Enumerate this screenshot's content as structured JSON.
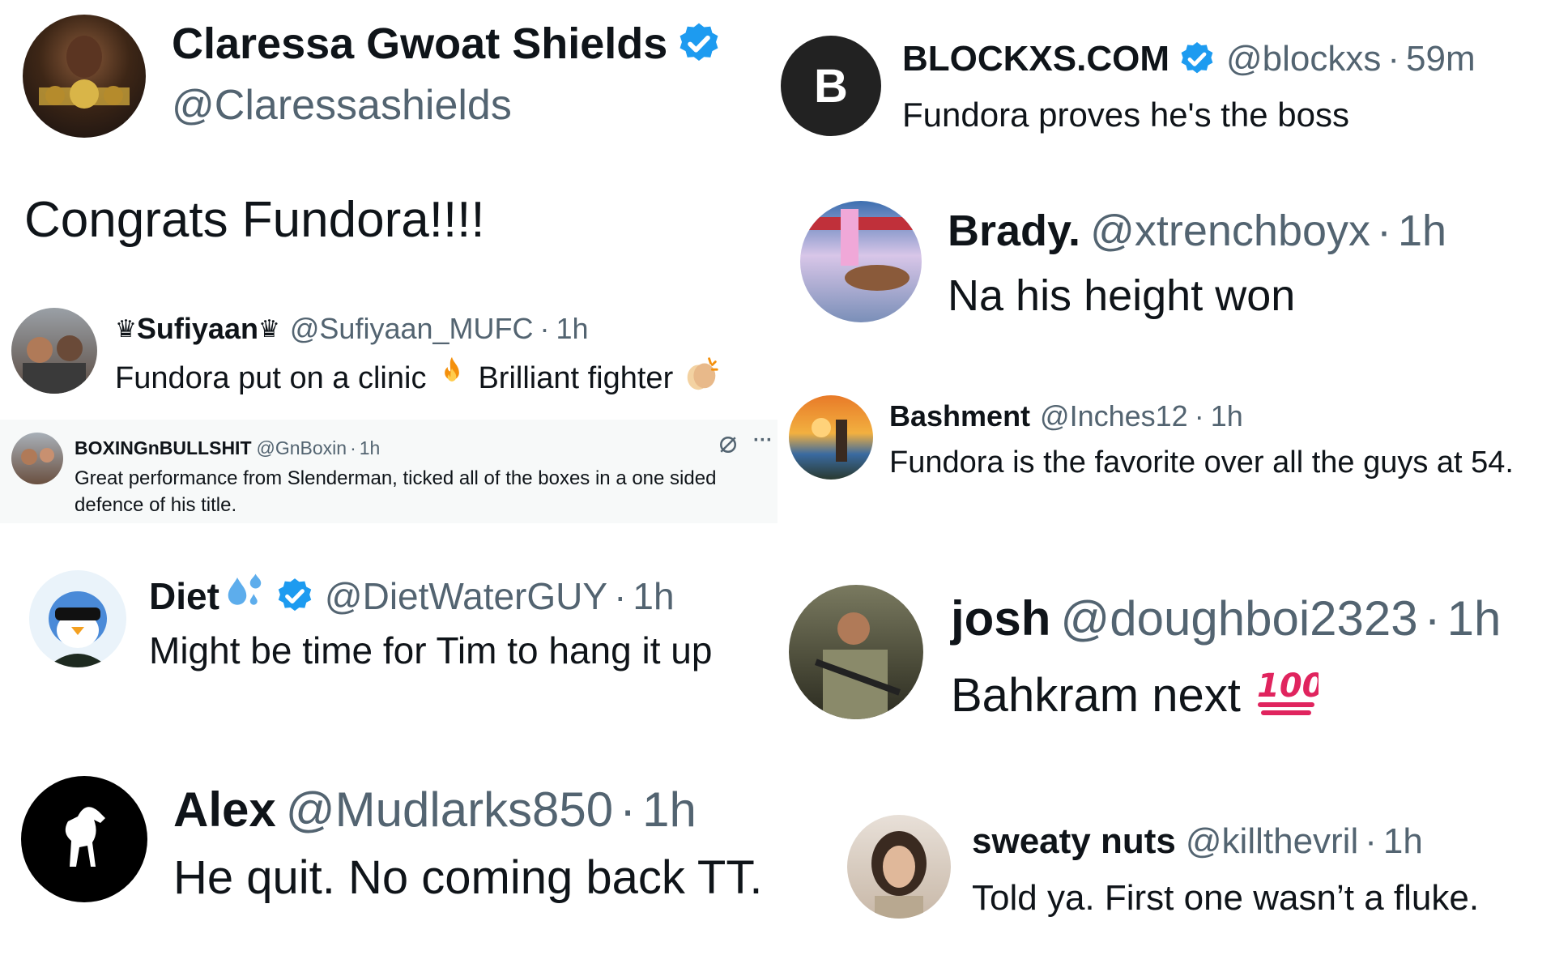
{
  "tweets": {
    "claressa": {
      "name": "Claressa Gwoat Shields",
      "handle": "@Claressashields",
      "text": "Congrats Fundora!!!!"
    },
    "blockxs": {
      "name": "BLOCKXS.COM",
      "handle": "@blockxs",
      "time": "59m",
      "text": "Fundora proves he's the boss",
      "avatar_letter": "B"
    },
    "brady": {
      "name": "Brady.",
      "handle": "@xtrenchboyx",
      "time": "1h",
      "text": "Na his height won"
    },
    "sufiyaan": {
      "name": "Sufiyaan",
      "crown": "♛",
      "handle": "@Sufiyaan_MUFC",
      "time": "1h",
      "text_part1": "Fundora put on a clinic",
      "text_part2": "Brilliant fighter"
    },
    "bashment": {
      "name": "Bashment",
      "handle": "@Inches12",
      "time": "1h",
      "text": "Fundora is the favorite over all the guys at 54."
    },
    "boxing": {
      "name": "BOXINGnBULLSHIT",
      "handle": "@GnBoxin",
      "time": "1h",
      "text": "Great performance from Slenderman, ticked all of the boxes in a one sided defence of his title.",
      "more": "···"
    },
    "diet": {
      "name": "Diet",
      "handle": "@DietWaterGUY",
      "time": "1h",
      "text": "Might be time for Tim to hang it up"
    },
    "josh": {
      "name": "josh",
      "handle": "@doughboi2323",
      "time": "1h",
      "text": "Bahkram next"
    },
    "alex": {
      "name": "Alex",
      "handle": "@Mudlarks850",
      "time": "1h",
      "text": "He quit. No coming back TT."
    },
    "sweaty": {
      "name": "sweaty nuts",
      "handle": "@killthevril",
      "time": "1h",
      "text": "Told ya. First one wasn’t a fluke."
    }
  },
  "separator": "·",
  "icons": {
    "verified": "verified-badge-icon",
    "fire": "fire-emoji-icon",
    "clap": "clapping-hands-emoji-icon",
    "droplets": "sweat-droplets-emoji-icon",
    "hundred": "hundred-points-emoji-icon",
    "grok": "grok-icon",
    "more": "more-options-icon"
  },
  "colors": {
    "verified_blue": "#1d9bf0",
    "handle_gray": "#536471",
    "text_dark": "#0f1419",
    "hundred_red": "#e0245e"
  }
}
